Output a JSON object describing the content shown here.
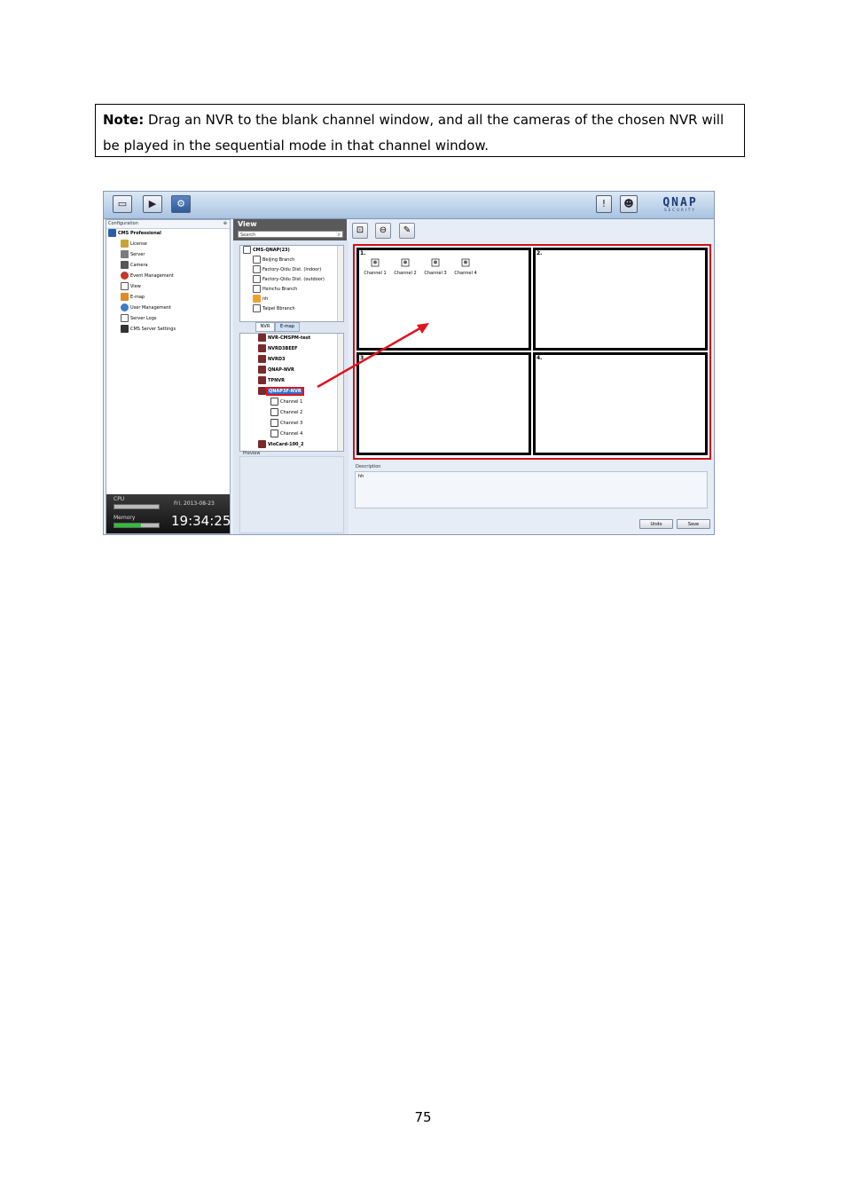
{
  "note": {
    "label": "Note:",
    "text": " Drag an NVR to the blank channel window, and all the cameras of the chosen NVR will be played in the sequential mode in that channel window."
  },
  "page_number": "75",
  "app": {
    "logo": "QNAP",
    "logo_sub": "SECURITY",
    "left_panel": {
      "header": "Configuration",
      "pin": "⊕",
      "root": "CMS Professional",
      "items": [
        "License",
        "Server",
        "Camera",
        "Event Management",
        "View",
        "E-map",
        "User Management",
        "Server Logs",
        "CMS Server Settings"
      ]
    },
    "status": {
      "cpu_label": "CPU",
      "memory_label": "Memory",
      "date": "Fri. 2013-08-23",
      "time": "19:34:25",
      "cpu_level": 0.0,
      "memory_level": 0.6
    },
    "view": {
      "title": "View",
      "search_placeholder": "Search",
      "site_tree": [
        "CMS-QNAP(23)",
        "Beijing Branch",
        "Factory-Qidu Dist. (indoor)",
        "Factory-Qidu Dist. (outdoor)",
        "Hsinchu Branch",
        "nh",
        "Taipei Bbranch"
      ],
      "tabs": [
        "NVR",
        "E-map"
      ],
      "nvr_tree": [
        "NVR-CMSPM-test",
        "NVRD3BEEF",
        "NVRD3",
        "QNAP-NVR",
        "TPNVR",
        "QNAP3F-NVR",
        "Channel 1",
        "Channel 2",
        "Channel 3",
        "Channel 4",
        "VioCard-100_2"
      ],
      "preview_label": "Preview"
    },
    "grid": {
      "cells": [
        "1.",
        "2.",
        "3.",
        "4."
      ],
      "cameras": [
        "Channel 1",
        "Channel 2",
        "Channel 3",
        "Channel 4"
      ]
    },
    "description": {
      "label": "Description",
      "value": "hh"
    },
    "buttons": {
      "undo": "Undo",
      "save": "Save"
    }
  }
}
